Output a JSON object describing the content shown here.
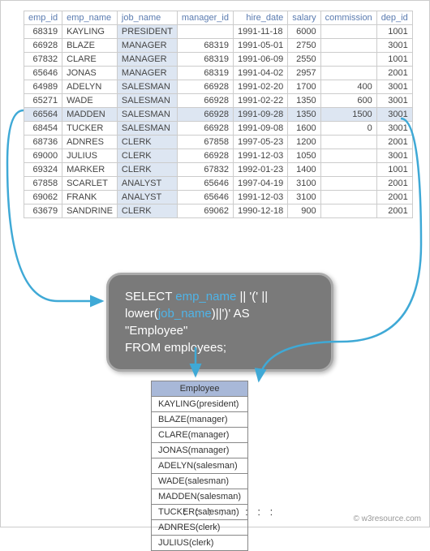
{
  "source": {
    "headers": [
      "emp_id",
      "emp_name",
      "job_name",
      "manager_id",
      "hire_date",
      "salary",
      "commission",
      "dep_id"
    ],
    "rows": [
      {
        "emp_id": "68319",
        "emp_name": "KAYLING",
        "job_name": "PRESIDENT",
        "manager_id": "",
        "hire_date": "1991-11-18",
        "salary": "6000",
        "commission": "",
        "dep_id": "1001"
      },
      {
        "emp_id": "66928",
        "emp_name": "BLAZE",
        "job_name": "MANAGER",
        "manager_id": "68319",
        "hire_date": "1991-05-01",
        "salary": "2750",
        "commission": "",
        "dep_id": "3001"
      },
      {
        "emp_id": "67832",
        "emp_name": "CLARE",
        "job_name": "MANAGER",
        "manager_id": "68319",
        "hire_date": "1991-06-09",
        "salary": "2550",
        "commission": "",
        "dep_id": "1001"
      },
      {
        "emp_id": "65646",
        "emp_name": "JONAS",
        "job_name": "MANAGER",
        "manager_id": "68319",
        "hire_date": "1991-04-02",
        "salary": "2957",
        "commission": "",
        "dep_id": "2001"
      },
      {
        "emp_id": "64989",
        "emp_name": "ADELYN",
        "job_name": "SALESMAN",
        "manager_id": "66928",
        "hire_date": "1991-02-20",
        "salary": "1700",
        "commission": "400",
        "dep_id": "3001"
      },
      {
        "emp_id": "65271",
        "emp_name": "WADE",
        "job_name": "SALESMAN",
        "manager_id": "66928",
        "hire_date": "1991-02-22",
        "salary": "1350",
        "commission": "600",
        "dep_id": "3001"
      },
      {
        "emp_id": "66564",
        "emp_name": "MADDEN",
        "job_name": "SALESMAN",
        "manager_id": "66928",
        "hire_date": "1991-09-28",
        "salary": "1350",
        "commission": "1500",
        "dep_id": "3001"
      },
      {
        "emp_id": "68454",
        "emp_name": "TUCKER",
        "job_name": "SALESMAN",
        "manager_id": "66928",
        "hire_date": "1991-09-08",
        "salary": "1600",
        "commission": "0",
        "dep_id": "3001"
      },
      {
        "emp_id": "68736",
        "emp_name": "ADNRES",
        "job_name": "CLERK",
        "manager_id": "67858",
        "hire_date": "1997-05-23",
        "salary": "1200",
        "commission": "",
        "dep_id": "2001"
      },
      {
        "emp_id": "69000",
        "emp_name": "JULIUS",
        "job_name": "CLERK",
        "manager_id": "66928",
        "hire_date": "1991-12-03",
        "salary": "1050",
        "commission": "",
        "dep_id": "3001"
      },
      {
        "emp_id": "69324",
        "emp_name": "MARKER",
        "job_name": "CLERK",
        "manager_id": "67832",
        "hire_date": "1992-01-23",
        "salary": "1400",
        "commission": "",
        "dep_id": "1001"
      },
      {
        "emp_id": "67858",
        "emp_name": "SCARLET",
        "job_name": "ANALYST",
        "manager_id": "65646",
        "hire_date": "1997-04-19",
        "salary": "3100",
        "commission": "",
        "dep_id": "2001"
      },
      {
        "emp_id": "69062",
        "emp_name": "FRANK",
        "job_name": "ANALYST",
        "manager_id": "65646",
        "hire_date": "1991-12-03",
        "salary": "3100",
        "commission": "",
        "dep_id": "2001"
      },
      {
        "emp_id": "63679",
        "emp_name": "SANDRINE",
        "job_name": "CLERK",
        "manager_id": "69062",
        "hire_date": "1990-12-18",
        "salary": "900",
        "commission": "",
        "dep_id": "2001"
      }
    ]
  },
  "sql": {
    "select": "SELECT ",
    "emp_name": "emp_name",
    "mid1": " || '(' ||",
    "lower": "lower(",
    "job_name": "job_name",
    "mid2": ")||')' AS \"Employee\"",
    "from": "FROM employees;"
  },
  "result": {
    "header": "Employee",
    "rows": [
      "KAYLING(president)",
      "BLAZE(manager)",
      "CLARE(manager)",
      "JONAS(manager)",
      "ADELYN(salesman)",
      "WADE(salesman)",
      "MADDEN(salesman)",
      "TUCKER(salesman)",
      "ADNRES(clerk)",
      "JULIUS(clerk)"
    ]
  },
  "ellipsis": ": : : : : : : :",
  "attribution": "© w3resource.com"
}
